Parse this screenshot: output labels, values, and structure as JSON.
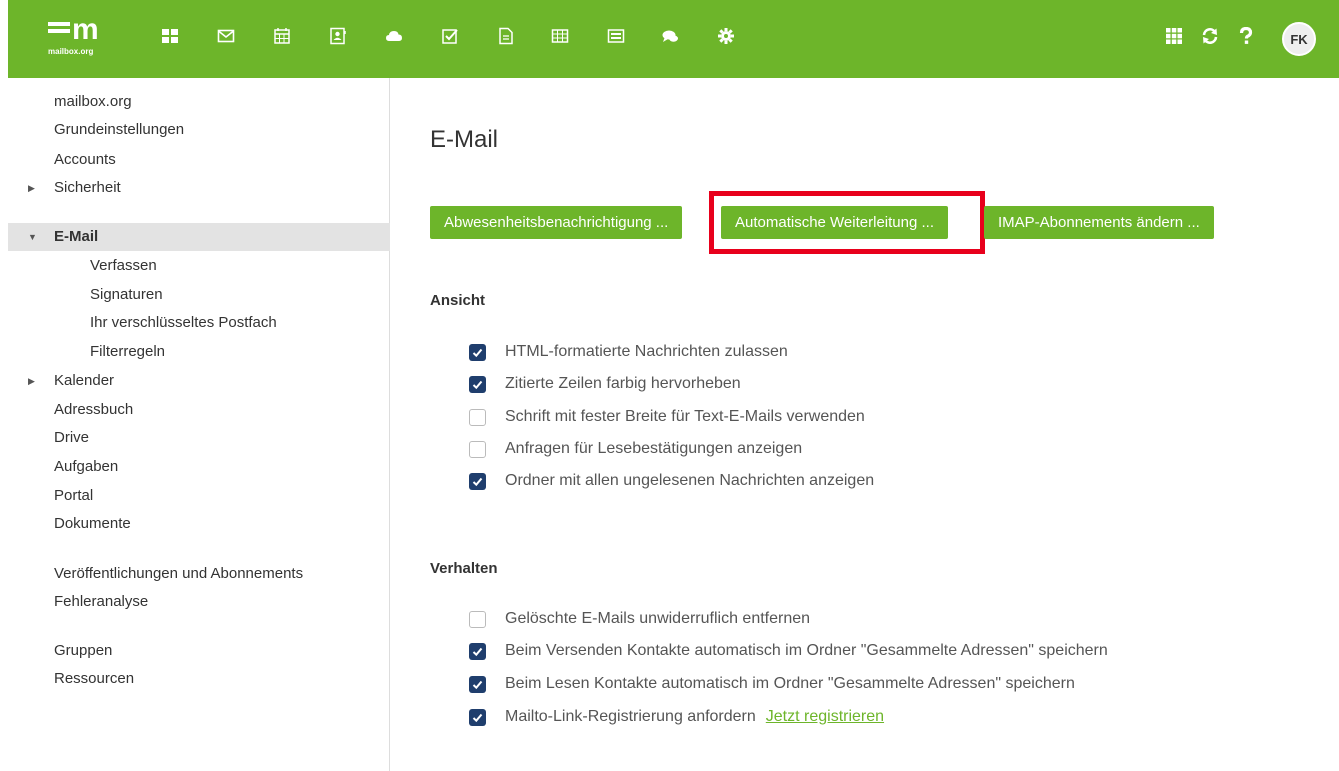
{
  "brand": {
    "logo_text": "m",
    "logo_sub": "mailbox.org",
    "accent": "#6db52a",
    "nav_active_bg": "#e3e3e3",
    "checkbox_color": "#1f3e6d",
    "highlight_color": "#e8001c"
  },
  "topbar": {
    "apps": [
      "portal-icon",
      "mail-icon",
      "calendar-icon",
      "addressbook-icon",
      "drive-icon",
      "tasks-icon",
      "text-icon",
      "spreadsheet-icon",
      "presentation-icon",
      "chat-icon",
      "settings-icon"
    ],
    "right_icons": [
      "app-launcher-icon",
      "refresh-icon",
      "help-icon"
    ],
    "avatar_initials": "FK"
  },
  "sidebar": {
    "items": [
      {
        "label": "mailbox.org"
      },
      {
        "label": "Grundeinstellungen"
      },
      {
        "label": "Accounts"
      },
      {
        "label": "Sicherheit",
        "caret": "▶"
      },
      {
        "label": "E-Mail",
        "caret": "▼"
      },
      {
        "label": "Verfassen"
      },
      {
        "label": "Signaturen"
      },
      {
        "label": "Ihr verschlüsseltes Postfach"
      },
      {
        "label": "Filterregeln"
      },
      {
        "label": "Kalender",
        "caret": "▶"
      },
      {
        "label": "Adressbuch"
      },
      {
        "label": "Drive"
      },
      {
        "label": "Aufgaben"
      },
      {
        "label": "Portal"
      },
      {
        "label": "Dokumente"
      },
      {
        "label": "Veröffentlichungen und Abonnements"
      },
      {
        "label": "Fehleranalyse"
      },
      {
        "label": "Gruppen"
      },
      {
        "label": "Ressourcen"
      }
    ]
  },
  "main": {
    "title": "E-Mail",
    "buttons": {
      "absence": "Abwesenheitsbenachrichtigung ...",
      "forward": "Automatische Weiterleitung ...",
      "imap": "IMAP-Abonnements ändern ..."
    },
    "view": {
      "title": "Ansicht",
      "options": [
        {
          "label": "HTML-formatierte Nachrichten zulassen",
          "checked": true
        },
        {
          "label": "Zitierte Zeilen farbig hervorheben",
          "checked": true
        },
        {
          "label": "Schrift mit fester Breite für Text-E-Mails verwenden",
          "checked": false
        },
        {
          "label": "Anfragen für Lesebestätigungen anzeigen",
          "checked": false
        },
        {
          "label": "Ordner mit allen ungelesenen Nachrichten anzeigen",
          "checked": true
        }
      ]
    },
    "behavior": {
      "title": "Verhalten",
      "options": [
        {
          "label": "Gelöschte E-Mails unwiderruflich entfernen",
          "checked": false
        },
        {
          "label": "Beim Versenden Kontakte automatisch im Ordner \"Gesammelte Adressen\" speichern",
          "checked": true
        },
        {
          "label": "Beim Lesen Kontakte automatisch im Ordner \"Gesammelte Adressen\" speichern",
          "checked": true
        },
        {
          "label": "Mailto-Link-Registrierung anfordern",
          "checked": true,
          "link": "Jetzt registrieren"
        }
      ]
    }
  }
}
